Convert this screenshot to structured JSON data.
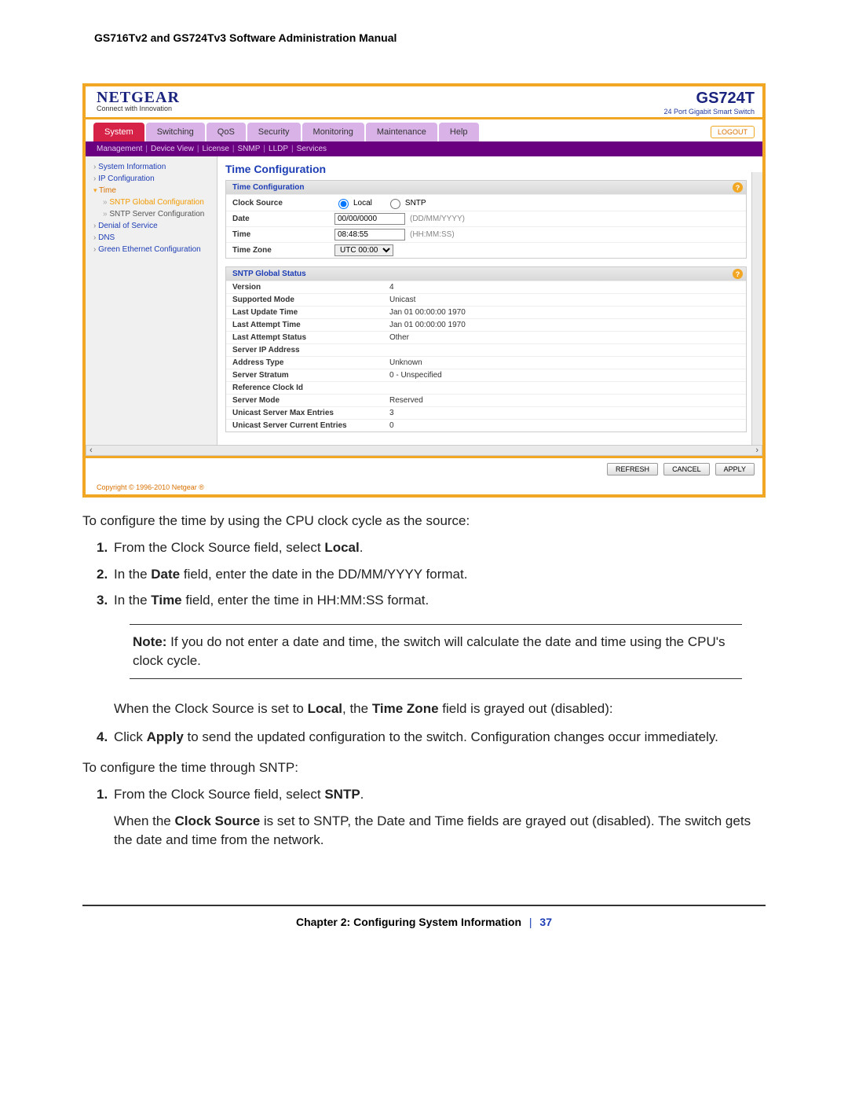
{
  "header_title": "GS716Tv2 and GS724Tv3 Software Administration Manual",
  "logo": {
    "name": "NETGEAR",
    "tag": "Connect with Innovation"
  },
  "model": {
    "name": "GS724T",
    "sub": "24 Port Gigabit Smart Switch"
  },
  "tabs": [
    "System",
    "Switching",
    "QoS",
    "Security",
    "Monitoring",
    "Maintenance",
    "Help"
  ],
  "active_tab": "System",
  "logout_label": "LOGOUT",
  "subtabs": [
    "Management",
    "Device View",
    "License",
    "SNMP",
    "LLDP",
    "Services"
  ],
  "sidenav": {
    "items": [
      {
        "label": "System Information",
        "level": 1
      },
      {
        "label": "IP Configuration",
        "level": 1
      },
      {
        "label": "Time",
        "level": 1,
        "expanded": true
      },
      {
        "label": "SNTP Global Configuration",
        "level": 2,
        "active": true
      },
      {
        "label": "SNTP Server Configuration",
        "level": 2
      },
      {
        "label": "Denial of Service",
        "level": 1
      },
      {
        "label": "DNS",
        "level": 1
      },
      {
        "label": "Green Ethernet Configuration",
        "level": 1
      }
    ]
  },
  "content": {
    "title": "Time Configuration",
    "panel1": {
      "heading": "Time Configuration",
      "rows": {
        "clock_source_label": "Clock Source",
        "clock_opt_local": "Local",
        "clock_opt_sntp": "SNTP",
        "date_label": "Date",
        "date_value": "00/00/0000",
        "date_hint": "(DD/MM/YYYY)",
        "time_label": "Time",
        "time_value": "08:48:55",
        "time_hint": "(HH:MM:SS)",
        "tz_label": "Time Zone",
        "tz_value": "UTC 00:00"
      }
    },
    "panel2": {
      "heading": "SNTP Global Status",
      "rows": [
        {
          "lbl": "Version",
          "val": "4"
        },
        {
          "lbl": "Supported Mode",
          "val": "Unicast"
        },
        {
          "lbl": "Last Update Time",
          "val": "Jan 01 00:00:00 1970"
        },
        {
          "lbl": "Last Attempt Time",
          "val": "Jan 01 00:00:00 1970"
        },
        {
          "lbl": "Last Attempt Status",
          "val": "Other"
        },
        {
          "lbl": "Server IP Address",
          "val": ""
        },
        {
          "lbl": "Address Type",
          "val": "Unknown"
        },
        {
          "lbl": "Server Stratum",
          "val": "0 - Unspecified"
        },
        {
          "lbl": "Reference Clock Id",
          "val": ""
        },
        {
          "lbl": "Server Mode",
          "val": "Reserved"
        },
        {
          "lbl": "Unicast Server Max Entries",
          "val": "3"
        },
        {
          "lbl": "Unicast Server Current Entries",
          "val": "0"
        }
      ]
    }
  },
  "footer_buttons": {
    "refresh": "REFRESH",
    "cancel": "CANCEL",
    "apply": "APPLY"
  },
  "copyright": "Copyright © 1996-2010 Netgear ®",
  "doc": {
    "lead1": "To configure the time by using the CPU clock cycle as the source:",
    "s1_1a": "From the Clock Source field, select ",
    "s1_1b": "Local",
    "s1_1c": ".",
    "s1_2a": "In the ",
    "s1_2b": "Date",
    "s1_2c": " field, enter the date in the DD/MM/YYYY format.",
    "s1_3a": "In the ",
    "s1_3b": "Time",
    "s1_3c": " field, enter the time in HH:MM:SS format.",
    "note_label": "Note:",
    "note_text": "  If you do not enter a date and time, the switch will calculate the date and time using the CPU's clock cycle.",
    "after_note_a": "When the Clock Source is set to ",
    "after_note_b": "Local",
    "after_note_c": ", the ",
    "after_note_d": "Time Zone",
    "after_note_e": " field is grayed out (disabled):",
    "s1_4a": "Click ",
    "s1_4b": "Apply",
    "s1_4c": " to send the updated configuration to the switch. Configuration changes occur immediately.",
    "lead2": "To configure the time through SNTP:",
    "s2_1a": "From the Clock Source field, select ",
    "s2_1b": "SNTP",
    "s2_1c": ".",
    "s2_body_a": "When the ",
    "s2_body_b": "Clock Source",
    "s2_body_c": " is set to SNTP, the Date and Time fields are grayed out (disabled). The switch gets the date and time from the network."
  },
  "page_footer": {
    "chapter": "Chapter 2:  Configuring System Information",
    "page": "37"
  }
}
